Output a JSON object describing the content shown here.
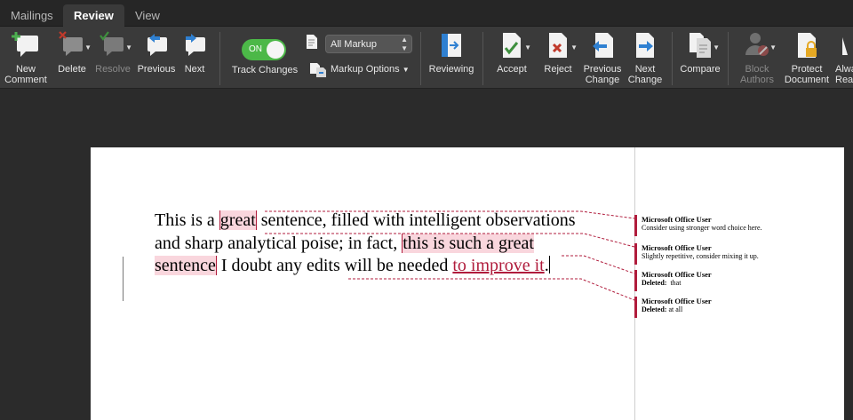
{
  "tabs": [
    "Mailings",
    "Review",
    "View"
  ],
  "ribbon": {
    "new_comment": "New Comment",
    "new_comment_l1": "New",
    "new_comment_l2": "Comment",
    "delete": "Delete",
    "resolve": "Resolve",
    "previous": "Previous",
    "next": "Next",
    "toggle_state": "ON",
    "track_changes": "Track Changes",
    "markup_select": "All Markup",
    "markup_options": "Markup Options",
    "reviewing": "Reviewing",
    "accept": "Accept",
    "reject": "Reject",
    "previous_change_l1": "Previous",
    "previous_change_l2": "Change",
    "next_change_l1": "Next",
    "next_change_l2": "Change",
    "compare": "Compare",
    "block_authors_l1": "Block",
    "block_authors_l2": "Authors",
    "protect_document_l1": "Protect",
    "protect_document_l2": "Document",
    "always_l1": "Alwa",
    "always_l2": "Rea"
  },
  "document": {
    "seg1": "This is a ",
    "seg2": "great",
    "seg3": " sentence, filled with intelligent observations and sharp analytical poise; in fact, ",
    "seg4": "this is such a great sentence",
    "seg5": " I doubt any edits will be needed ",
    "seg6": "to improve it",
    "seg7": "."
  },
  "comments": [
    {
      "author": "Microsoft Office User",
      "text": "Consider using stronger word choice here."
    },
    {
      "author": "Microsoft Office User",
      "text": "Slightly repetitive, consider mixing it up."
    },
    {
      "author": "Microsoft Office User",
      "label": "Deleted:",
      "text": "that"
    },
    {
      "author": "Microsoft Office User",
      "label": "Deleted:",
      "text": "at all"
    }
  ],
  "colors": {
    "accent": "#b01c3c",
    "comment_highlight": "#f9d6dd",
    "toggle_on": "#4cb848"
  }
}
